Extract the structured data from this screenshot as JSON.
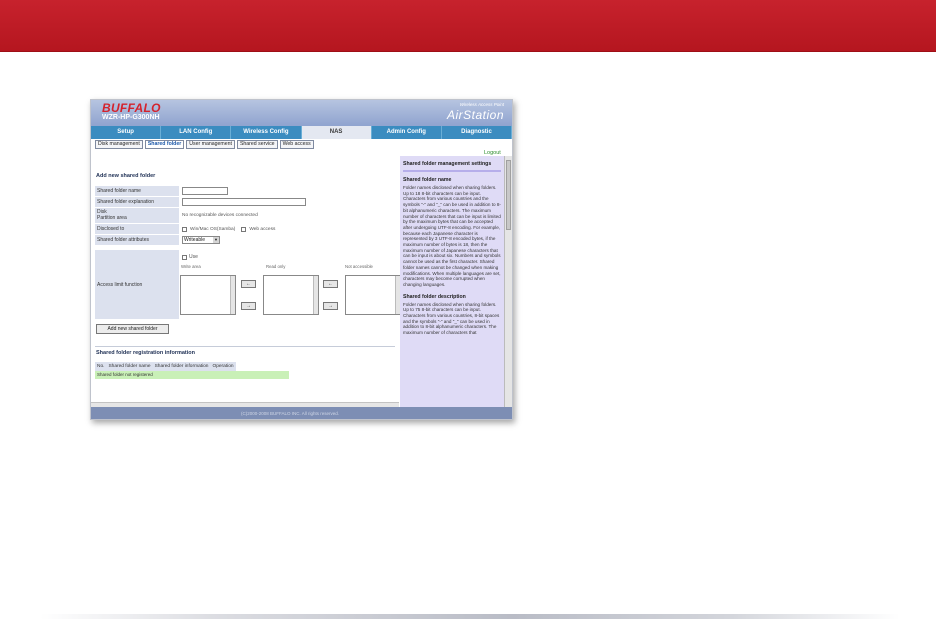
{
  "colors": {
    "banner": "#c7222d",
    "tabbar": "#3b8cc0",
    "help_bg": "#dfdbf6",
    "empty_row": "#c9f0b7"
  },
  "header": {
    "brand": "BUFFALO",
    "model": "WZR-HP-G300NH",
    "product_tag": "Wireless Access Point",
    "product_name": "AirStation"
  },
  "tabs": [
    "Setup",
    "LAN Config",
    "Wireless Config",
    "NAS",
    "Admin Config",
    "Diagnostic"
  ],
  "active_tab": "NAS",
  "subtabs": [
    "Disk management",
    "Shared folder",
    "User management",
    "Shared service",
    "Web access"
  ],
  "active_subtab": "Shared folder",
  "logout": "Logout",
  "form": {
    "title": "Add new shared folder",
    "name_label": "Shared folder name",
    "name_value": "",
    "explanation_label": "Shared folder explanation",
    "explanation_value": "",
    "disk_label_1": "Disk",
    "disk_label_2": "Partition area",
    "disk_value": "No recognizable devices connected",
    "disclosed_label": "Disclosed to",
    "disclosed_opt1": "Win/Mac OS(Samba)",
    "disclosed_opt2": "Web access",
    "attributes_label": "Shared folder attributes",
    "attributes_value": "Writeable",
    "access_label": "Access limit function",
    "use_label": "Use",
    "col_write": "Write area",
    "col_read": "Read only",
    "col_none": "Not accessible",
    "move_left": "←",
    "move_right": "→",
    "add_button": "Add new shared folder"
  },
  "registration": {
    "title": "Shared folder registration information",
    "columns": [
      "No.",
      "Shared folder name",
      "Shared folder information",
      "Operation"
    ],
    "empty_text": "Shared folder not registered"
  },
  "footer": "(C)2000-2008 BUFFALO INC. All rights reserved.",
  "help": {
    "title": "Shared folder management settings",
    "sections": [
      {
        "heading": "Shared folder name",
        "text": "Folder names disclosed when sharing folders. Up to 18 8-bit characters can be input. Characters from various countries and the symbols \"-\" and \"_\" can be used in addition to 8-bit alphanumeric characters. The maximum number of characters that can be input is limited by the maximum bytes that can be accepted after undergoing UTF-8 encoding. For example, because each Japanese character is represented by 3 UTF-8 encoded bytes, if the maximum number of bytes is 18, then the maximum number of Japanese characters that can be input is about six. Numbers and symbols cannot be used as the first character. Shared folder names cannot be changed when making modifications. When multiple languages are set, characters may become corrupted when changing languages."
      },
      {
        "heading": "Shared folder description",
        "text": "Folder names disclosed when sharing folders. Up to 75 8-bit characters can be input. Characters from various countries, 8-bit spaces and the symbols \"-\" and \"_\" can be used in addition to 8-bit alphanumeric characters. The maximum number of characters that"
      }
    ]
  }
}
